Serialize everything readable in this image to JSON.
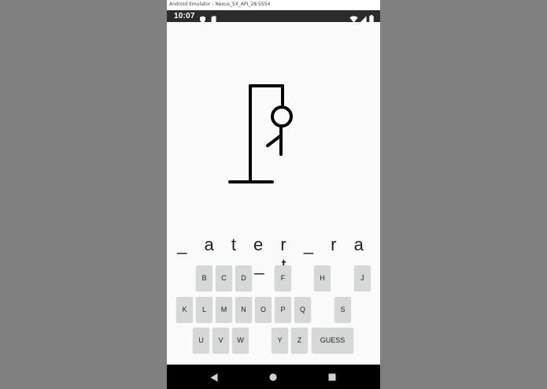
{
  "window": {
    "title": "Android Emulator - Nexus_5X_API_28:5554"
  },
  "statusbar": {
    "time": "10:07",
    "left_icons": [
      "shield-icon",
      "sd-card-icon"
    ],
    "right_icons": [
      "wifi-icon",
      "signal-icon",
      "battery-icon"
    ]
  },
  "game": {
    "word_display": "_ a t e r _ r a _ t",
    "keyboard": {
      "row1": [
        "B",
        "C",
        "D",
        "F",
        "H",
        "J"
      ],
      "row2": [
        "K",
        "L",
        "M",
        "N",
        "O",
        "P",
        "Q",
        "S"
      ],
      "row3": [
        "U",
        "V",
        "W",
        "Y",
        "Z"
      ],
      "guess_label": "GUESS"
    }
  },
  "navbar": {
    "buttons": [
      "back-icon",
      "home-icon",
      "recents-icon"
    ]
  },
  "colors": {
    "background": "#808080",
    "screen": "#fafafa",
    "statusbar": "#2b2b2b",
    "key": "#d6d7d7",
    "drawing": "#000000",
    "navbar": "#000000"
  }
}
